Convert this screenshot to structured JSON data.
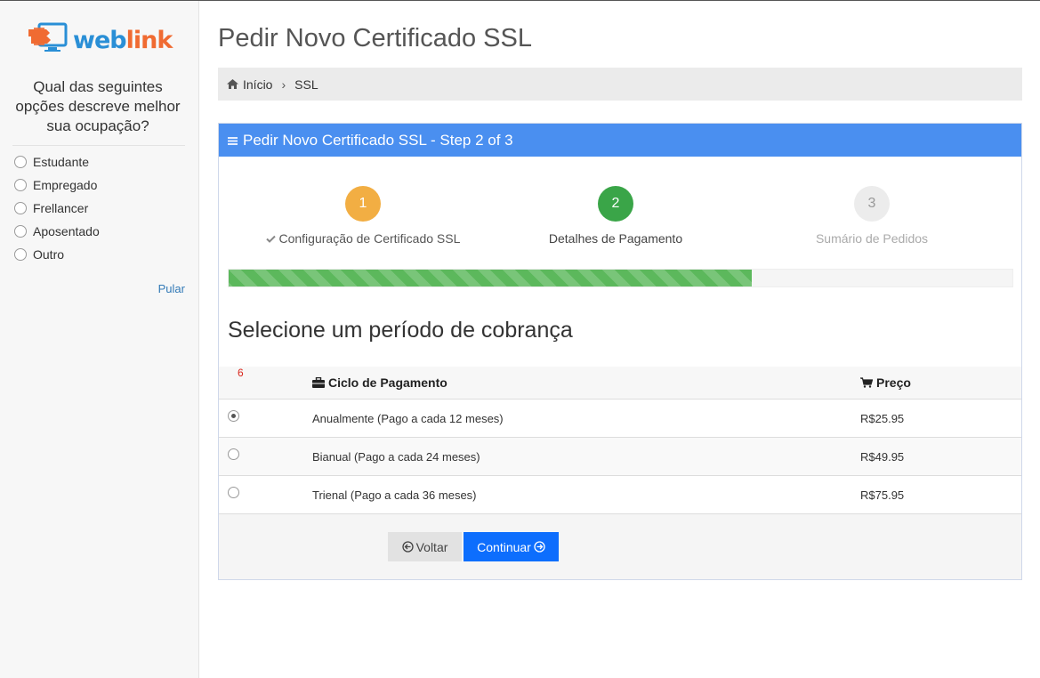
{
  "brand": {
    "logo_text_main": "web",
    "logo_text_accent": "link",
    "primary": "#2a8fd6",
    "accent": "#f06b32"
  },
  "survey": {
    "question": "Qual das seguintes opções descreve melhor sua ocupação?",
    "options": [
      "Estudante",
      "Empregado",
      "Frellancer",
      "Aposentado",
      "Outro"
    ],
    "skip": "Pular"
  },
  "page": {
    "title": "Pedir Novo Certificado SSL"
  },
  "breadcrumb": {
    "home": "Início",
    "current": "SSL"
  },
  "panel": {
    "heading": "Pedir Novo Certificado SSL - Step 2 of 3",
    "heading_color": "#4a8ff0",
    "steps": [
      {
        "number": "1",
        "label": "Configuração de Certificado SSL",
        "state": "completed",
        "color": "#f2ae43"
      },
      {
        "number": "2",
        "label": "Detalhes de Pagamento",
        "state": "active",
        "color": "#3aa548"
      },
      {
        "number": "3",
        "label": "Sumário de Pedidos",
        "state": "pending",
        "color": "#ececec"
      }
    ],
    "progress_percent": 66.7,
    "progress_color": "#5cb85c",
    "section_title": "Selecione um período de cobrança",
    "table": {
      "marker": "6",
      "col_cycle": "Ciclo de Pagamento",
      "col_price": "Preço",
      "rows": [
        {
          "cycle": "Anualmente (Pago a cada 12 meses)",
          "price": "R$25.95",
          "selected": true
        },
        {
          "cycle": "Bianual (Pago a cada 24 meses)",
          "price": "R$49.95",
          "selected": false
        },
        {
          "cycle": "Trienal (Pago a cada 36 meses)",
          "price": "R$75.95",
          "selected": false
        }
      ]
    },
    "buttons": {
      "back": "Voltar",
      "next": "Continuar",
      "next_color": "#0d6efd"
    }
  }
}
